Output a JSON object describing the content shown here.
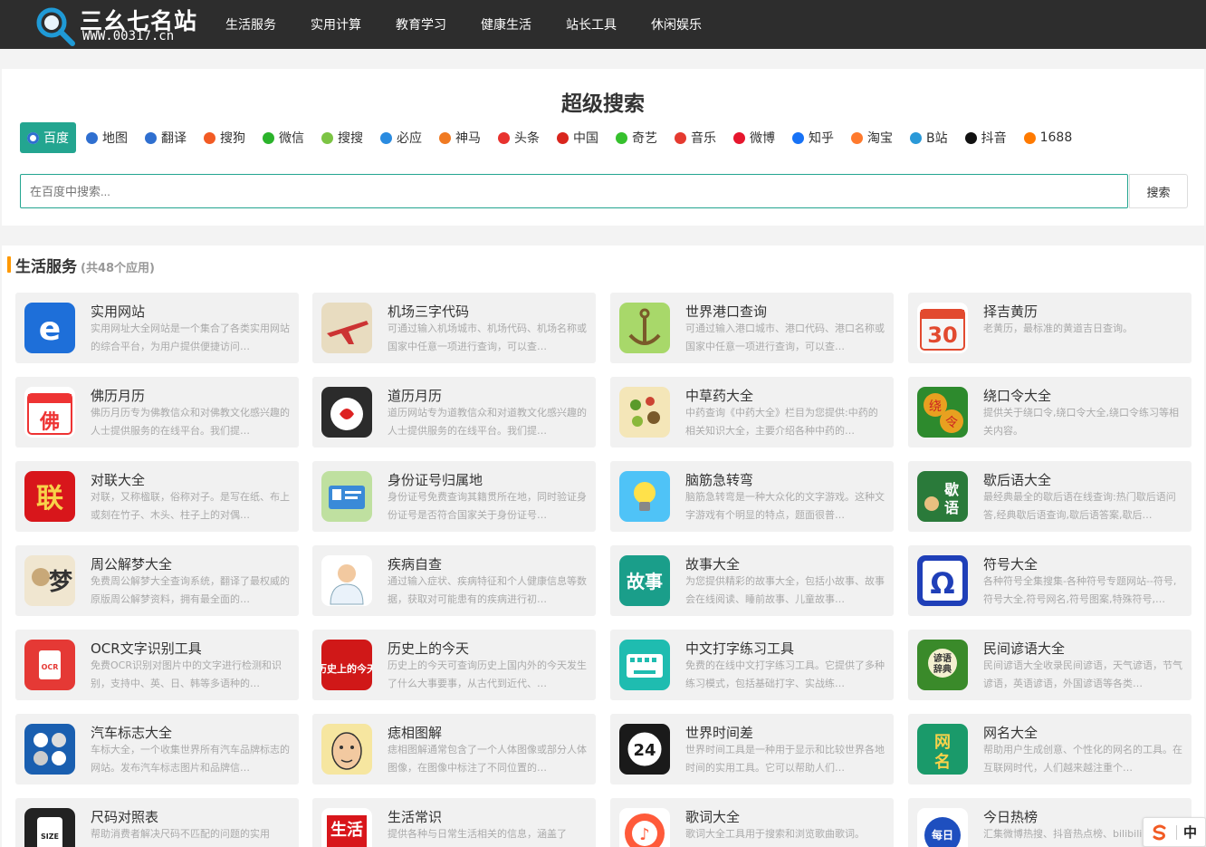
{
  "site": {
    "title": "三幺七名站",
    "url": "WWW.00317.cn"
  },
  "nav": [
    "生活服务",
    "实用计算",
    "教育学习",
    "健康生活",
    "站长工具",
    "休闲娱乐"
  ],
  "search": {
    "title": "超级搜索",
    "placeholder": "在百度中搜索...",
    "button": "搜索",
    "engines": [
      {
        "label": "百度",
        "icon": "baidu-paw-icon",
        "color": "#2f6fd0",
        "active": true
      },
      {
        "label": "地图",
        "icon": "map-paw-icon",
        "color": "#2f6fd0"
      },
      {
        "label": "翻译",
        "icon": "translate-paw-icon",
        "color": "#2f6fd0"
      },
      {
        "label": "搜狗",
        "icon": "sogou-icon",
        "color": "#f25b24"
      },
      {
        "label": "微信",
        "icon": "wechat-icon",
        "color": "#2bb32b"
      },
      {
        "label": "搜搜",
        "icon": "soso-icon",
        "color": "#7cc444"
      },
      {
        "label": "必应",
        "icon": "bing-icon",
        "color": "#2a8be0"
      },
      {
        "label": "神马",
        "icon": "shenma-icon",
        "color": "#f07a22"
      },
      {
        "label": "头条",
        "icon": "toutiao-icon",
        "color": "#e8322e"
      },
      {
        "label": "中国",
        "icon": "chinaso-icon",
        "color": "#d9251d"
      },
      {
        "label": "奇艺",
        "icon": "iqiyi-icon",
        "color": "#36c12d"
      },
      {
        "label": "音乐",
        "icon": "music-icon",
        "color": "#e53a30"
      },
      {
        "label": "微博",
        "icon": "weibo-icon",
        "color": "#e6162d"
      },
      {
        "label": "知乎",
        "icon": "zhihu-icon",
        "color": "#1772f6"
      },
      {
        "label": "淘宝",
        "icon": "taobao-icon",
        "color": "#ff7a2d"
      },
      {
        "label": "B站",
        "icon": "bilibili-icon",
        "color": "#2a99d8"
      },
      {
        "label": "抖音",
        "icon": "douyin-icon",
        "color": "#111111"
      },
      {
        "label": "1688",
        "icon": "1688-icon",
        "color": "#ff7a00"
      }
    ]
  },
  "section": {
    "title": "生活服务",
    "count": "(共48个应用)"
  },
  "apps": [
    {
      "title": "实用网站",
      "desc": "实用网址大全网站是一个集合了各类实用网站的综合平台，为用户提供便捷访问…",
      "icon": "ie-browser-icon",
      "bg": "#ffffff"
    },
    {
      "title": "机场三字代码",
      "desc": "可通过输入机场城市、机场代码、机场名称或国家中任意一项进行查询，可以查…",
      "icon": "airplane-icon",
      "bg": "#e8e0c8"
    },
    {
      "title": "世界港口查询",
      "desc": "可通过输入港口城市、港口代码、港口名称或国家中任意一项进行查询，可以查…",
      "icon": "anchor-icon",
      "bg": "#b8e07a"
    },
    {
      "title": "择吉黄历",
      "desc": "老黄历，最标准的黄道吉日查询。",
      "icon": "calendar-30-icon",
      "bg": "#ffffff"
    },
    {
      "title": "佛历月历",
      "desc": "佛历月历专为佛教信众和对佛教文化感兴趣的人士提供服务的在线平台。我们提…",
      "icon": "buddha-calendar-icon",
      "bg": "#ffffff"
    },
    {
      "title": "道历月历",
      "desc": "道历网站专为道教信众和对道教文化感兴趣的人士提供服务的在线平台。我们提…",
      "icon": "taoist-calendar-icon",
      "bg": "#333333"
    },
    {
      "title": "中草药大全",
      "desc": "中药查询《中药大全》栏目为您提供:中药的相关知识大全，主要介绍各种中药的…",
      "icon": "herbs-icon",
      "bg": "#f4e6b8"
    },
    {
      "title": "绕口令大全",
      "desc": "提供关于绕口令,绕口令大全,绕口令练习等相关内容。",
      "icon": "tongue-twister-icon",
      "bg": "#2d8a2d"
    },
    {
      "title": "对联大全",
      "desc": "对联，又称楹联，俗称对子。是写在纸、布上或刻在竹子、木头、柱子上的对偶…",
      "icon": "couplet-icon",
      "bg": "#d8161b"
    },
    {
      "title": "身份证号归属地",
      "desc": "身份证号免费查询其籍贯所在地，同时验证身份证号是否符合国家关于身份证号…",
      "icon": "id-card-icon",
      "bg": "#bfe0a0"
    },
    {
      "title": "脑筋急转弯",
      "desc": "脑筋急转弯是一种大众化的文字游戏。这种文字游戏有个明显的特点，题面很普…",
      "icon": "lightbulb-icon",
      "bg": "#4fc3f7"
    },
    {
      "title": "歇后语大全",
      "desc": "最经典最全的歇后语在线查询:热门歇后语问答,经典歇后语查询,歇后语答案,歇后…",
      "icon": "xiehouyu-icon",
      "bg": "#2a7a3a"
    },
    {
      "title": "周公解梦大全",
      "desc": "免费周公解梦大全查询系统，翻译了最权威的原版周公解梦资料，拥有最全面的…",
      "icon": "dream-icon",
      "bg": "#f0e6d0"
    },
    {
      "title": "疾病自查",
      "desc": "通过输入症状、疾病特征和个人健康信息等数据，获取对可能患有的疾病进行初…",
      "icon": "doctor-icon",
      "bg": "#ffffff"
    },
    {
      "title": "故事大全",
      "desc": "为您提供精彩的故事大全，包括小故事、故事会在线阅读、睡前故事、儿童故事…",
      "icon": "story-icon",
      "bg": "#1a9e8a",
      "text": "故事"
    },
    {
      "title": "符号大全",
      "desc": "各种符号全集搜集-各种符号专题网站--符号,符号大全,符号网名,符号图案,特殊符号,…",
      "icon": "omega-icon",
      "bg": "#1f3fb8"
    },
    {
      "title": "OCR文字识别工具",
      "desc": "免费OCR识别对图片中的文字进行检测和识别，支持中、英、日、韩等多语种的…",
      "icon": "ocr-icon",
      "bg": "#e53935"
    },
    {
      "title": "历史上的今天",
      "desc": "历史上的今天可查询历史上国内外的今天发生了什么大事要事，从古代到近代、…",
      "icon": "history-icon",
      "bg": "#d01818",
      "text": "历史上的今天"
    },
    {
      "title": "中文打字练习工具",
      "desc": "免费的在线中文打字练习工具。它提供了多种练习模式，包括基础打字、实战练…",
      "icon": "keyboard-icon",
      "bg": "#1fbcb0"
    },
    {
      "title": "民间谚语大全",
      "desc": "民间谚语大全收录民间谚语，天气谚语，节气谚语，英语谚语，外国谚语等各类…",
      "icon": "proverb-book-icon",
      "bg": "#3a8a2a"
    },
    {
      "title": "汽车标志大全",
      "desc": "车标大全，一个收集世界所有汽车品牌标志的网站。发布汽车标志图片和品牌信…",
      "icon": "car-logo-icon",
      "bg": "#1a5fb0"
    },
    {
      "title": "痣相图解",
      "desc": "痣相图解通常包含了一个人体图像或部分人体图像，在图像中标注了不同位置的…",
      "icon": "face-mole-icon",
      "bg": "#f6e6a0"
    },
    {
      "title": "世界时间差",
      "desc": "世界时间工具是一种用于显示和比较世界各地时间的实用工具。它可以帮助人们…",
      "icon": "clock-24-icon",
      "bg": "#1a1a1a"
    },
    {
      "title": "网名大全",
      "desc": "帮助用户生成创意、个性化的网名的工具。在互联网时代，人们越来越注重个…",
      "icon": "netname-icon",
      "bg": "#1a9a6a"
    },
    {
      "title": "尺码对照表",
      "desc": "帮助消费者解决尺码不匹配的问题的实用",
      "icon": "size-tag-icon",
      "bg": "#222222"
    },
    {
      "title": "生活常识",
      "desc": "提供各种与日常生活相关的信息，涵盖了",
      "icon": "life-tips-icon",
      "bg": "#ffffff"
    },
    {
      "title": "歌词大全",
      "desc": "歌词大全工具用于搜索和浏览歌曲歌词。",
      "icon": "lyrics-icon",
      "bg": "#ffffff"
    },
    {
      "title": "今日热榜",
      "desc": "汇集微博热搜、抖音热点榜、bilibili",
      "icon": "hot-list-icon",
      "bg": "#ffffff"
    }
  ],
  "lang_switch": {
    "label": "中"
  }
}
